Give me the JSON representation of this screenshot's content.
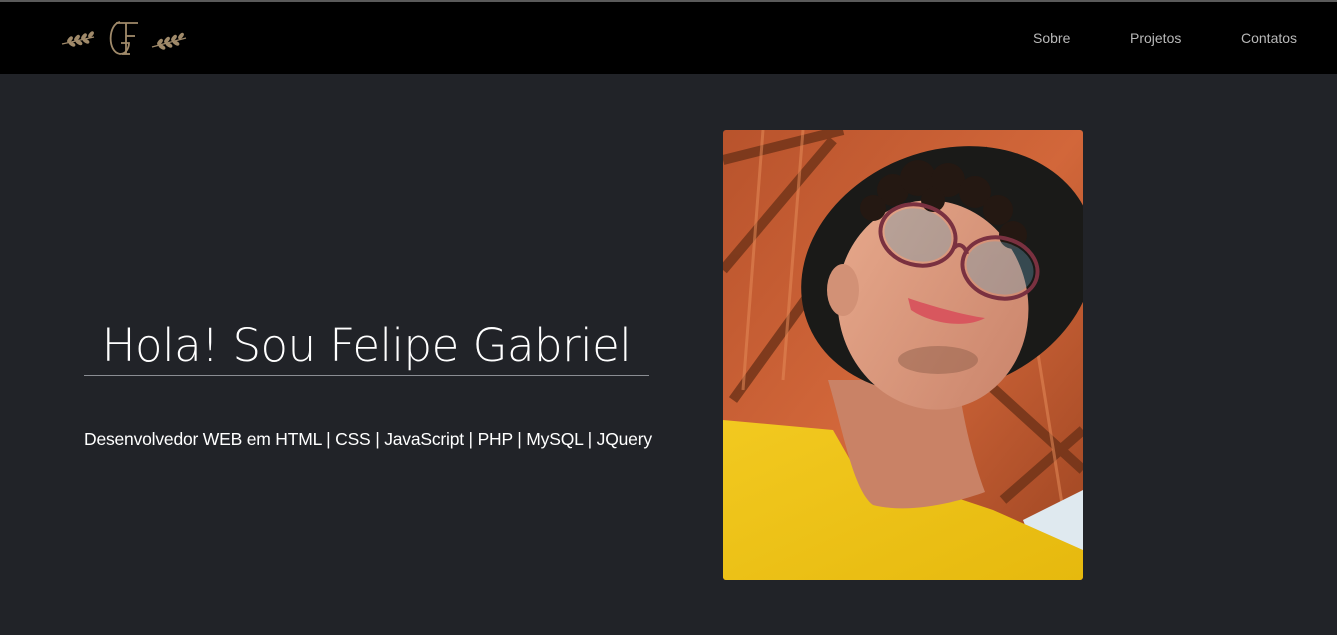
{
  "brand": {
    "logo_icon": "monogram-fg-laurel-logo",
    "accent_color": "#a08a6a"
  },
  "nav": {
    "items": [
      {
        "label": "Sobre"
      },
      {
        "label": "Projetos"
      },
      {
        "label": "Contatos"
      }
    ]
  },
  "hero": {
    "title": "Hola! Sou Felipe Gabriel",
    "subtitle": "Desenvolvedor WEB em HTML | CSS | JavaScript | PHP | MySQL | JQuery",
    "photo_icon": "profile-photo"
  },
  "colors": {
    "background": "#212328",
    "navbar": "#000000",
    "nav_text": "#b9b9b9",
    "text": "#ffffff"
  }
}
